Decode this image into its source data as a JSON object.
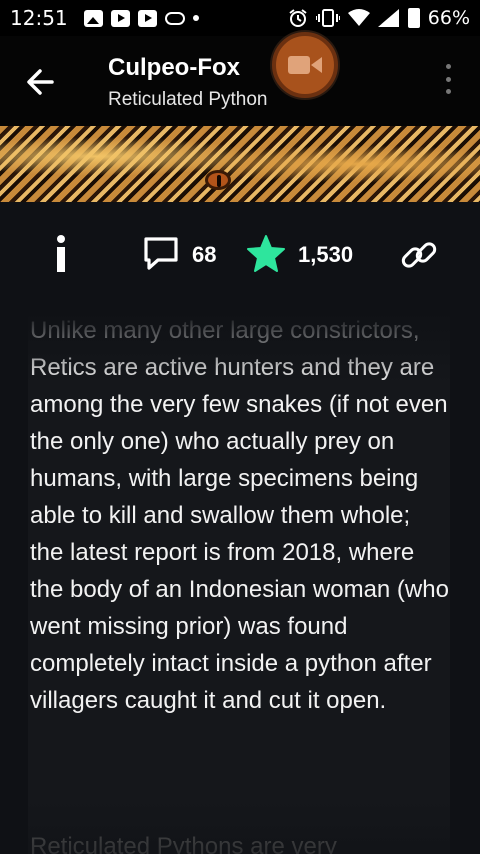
{
  "status_bar": {
    "time": "12:51",
    "battery": "66%",
    "left_icons": [
      "gallery-icon",
      "youtube-icon",
      "youtube-icon",
      "cloud-icon",
      "dot-icon"
    ],
    "right_icons": [
      "alarm-icon",
      "vibrate-icon",
      "wifi-icon",
      "signal-icon",
      "battery-icon"
    ]
  },
  "header": {
    "title": "Culpeo-Fox",
    "subtitle": "Reticulated Python",
    "back_icon": "arrow-left-icon",
    "video_icon": "video-camera-icon",
    "more_icon": "more-vertical-icon",
    "video_button_color": "#a8521c"
  },
  "stats": {
    "comments": "68",
    "likes": "1,530",
    "star_color": "#2ee59d",
    "icons": [
      "info-icon",
      "comment-icon",
      "star-icon",
      "link-icon"
    ]
  },
  "article": {
    "paragraph": "Unlike many other large constrictors, Retics are active hunters and they are among the very few snakes (if not even the only one) who actually prey on humans, with large specimens being able to kill and swallow them whole; the latest report is from 2018, where the body of an Indonesian woman (who went missing prior) was found completely intact inside a python after villagers caught it and cut it open.",
    "next_paragraph_start": "Reticulated Pythons are very"
  }
}
